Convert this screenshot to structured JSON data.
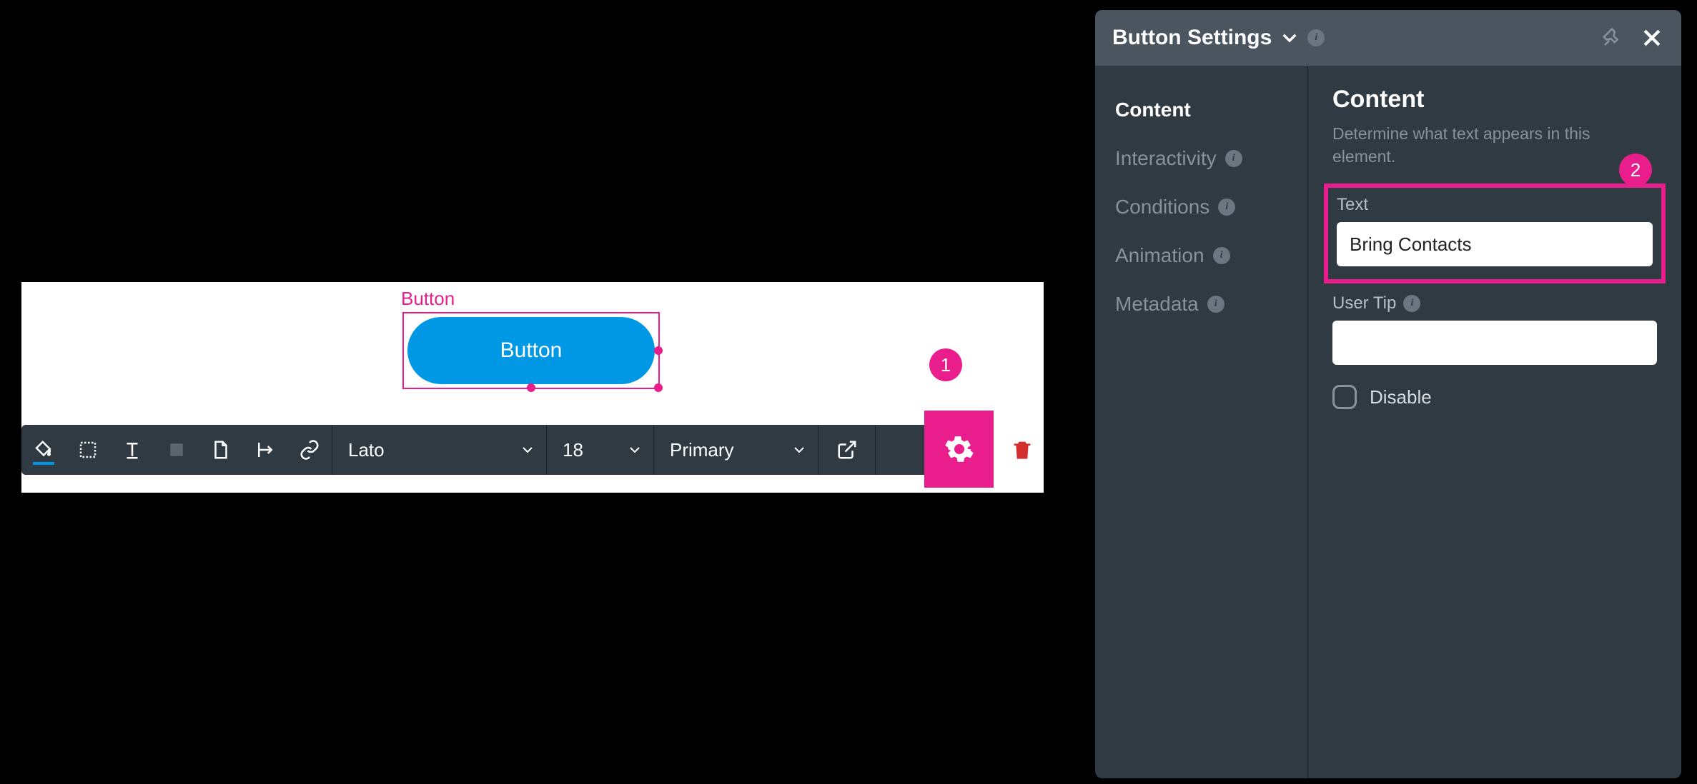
{
  "canvas": {
    "element_label": "Button",
    "button_text": "Button"
  },
  "toolbar": {
    "font": "Lato",
    "size": "18",
    "style": "Primary"
  },
  "badges": {
    "one": "1",
    "two": "2"
  },
  "panel": {
    "title": "Button Settings",
    "sidebar": {
      "content": "Content",
      "interactivity": "Interactivity",
      "conditions": "Conditions",
      "animation": "Animation",
      "metadata": "Metadata"
    },
    "content": {
      "heading": "Content",
      "subtitle": "Determine what text appears in this element.",
      "text_label": "Text",
      "text_value": "Bring Contacts",
      "user_tip_label": "User Tip",
      "user_tip_value": "",
      "disable_label": "Disable"
    }
  }
}
